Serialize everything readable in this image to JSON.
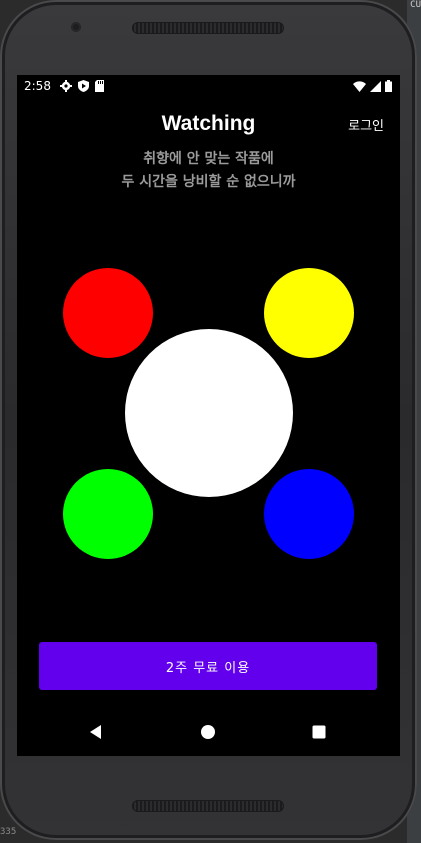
{
  "ide": {
    "top_text": "CU",
    "bottom_text": "335"
  },
  "status_bar": {
    "time": "2:58",
    "left_icons": [
      "settings-icon",
      "shield-icon",
      "play-icon",
      "sd-card-icon"
    ],
    "right_icons": [
      "wifi-icon",
      "signal-icon",
      "battery-icon"
    ]
  },
  "header": {
    "title": "Watching",
    "login_label": "로그인"
  },
  "tagline": {
    "line1": "취향에 안 맞는 작품에",
    "line2": "두 시간을 낭비할 순 없으니까"
  },
  "circles": {
    "red": "#ff0000",
    "yellow": "#ffff00",
    "green": "#00ff00",
    "blue": "#0000ff",
    "white": "#ffffff"
  },
  "cta": {
    "label": "2주 무료 이용",
    "color": "#6200ee"
  },
  "nav": {
    "items": [
      "back-icon",
      "home-icon",
      "recents-icon"
    ]
  }
}
